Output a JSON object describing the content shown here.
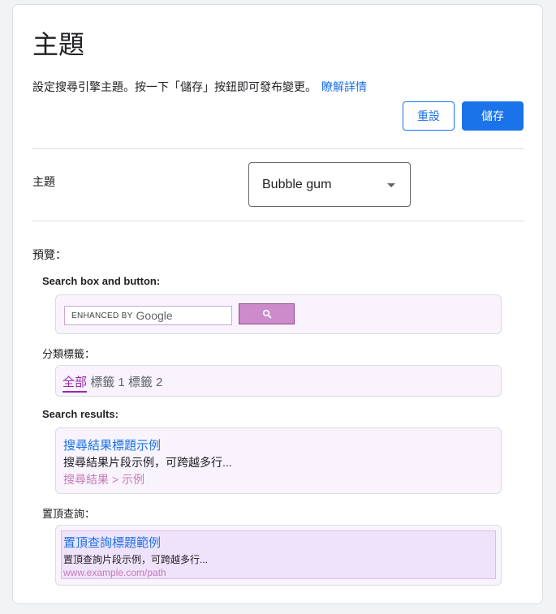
{
  "header": {
    "title": "主題",
    "description": "設定搜尋引擎主題。按一下「儲存」按鈕即可發布變更。",
    "learn_more": "瞭解詳情"
  },
  "actions": {
    "reset_label": "重設",
    "save_label": "儲存"
  },
  "theme": {
    "label": "主題",
    "selected": "Bubble gum"
  },
  "preview": {
    "label": "預覽：",
    "search_box_label": "Search box and button:",
    "search_box_brand_prefix": "ENHANCED BY",
    "search_box_brand": "Google",
    "tabs_label": "分類標籤：",
    "tabs": [
      "全部",
      "標籤 1",
      "標籤 2"
    ],
    "results_label": "Search results:",
    "result": {
      "title": "搜尋結果標題示例",
      "snippet": "搜尋結果片段示例，可跨越多行...",
      "url": "搜尋結果 > 示例"
    },
    "promotions_label": "置頂查詢：",
    "promotion": {
      "title": "置頂查詢標題範例",
      "snippet": "置頂查詢片段示例，可跨越多行...",
      "url": "www.example.com/path"
    }
  },
  "colors": {
    "accent": "#1a73e8",
    "theme_purple": "#9c27b0",
    "search_button": "#cc8ccc",
    "preview_bg": "#f8f3fc",
    "promo_bg": "#efe2fb",
    "url_color": "#c77bb6"
  }
}
